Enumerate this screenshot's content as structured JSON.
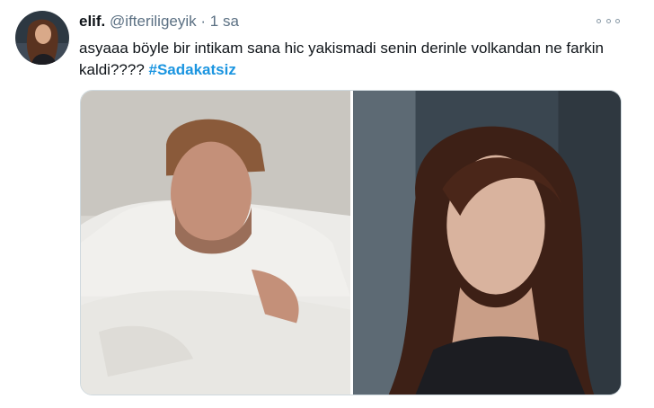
{
  "tweet": {
    "author_name": "elif.",
    "handle": "@ifteriligeyik",
    "separator": "·",
    "time": "1 sa",
    "text": "asyaaa böyle bir intikam sana hic yakismadi senin derinle volkandan ne farkin kaldi????",
    "hashtag": "#Sadakatsiz"
  },
  "media": {
    "images": [
      {
        "subject": "man-in-bed-photo"
      },
      {
        "subject": "woman-portrait-photo"
      }
    ]
  },
  "colors": {
    "text": "#0f1419",
    "muted": "#5b7083",
    "link": "#1b95e0"
  }
}
